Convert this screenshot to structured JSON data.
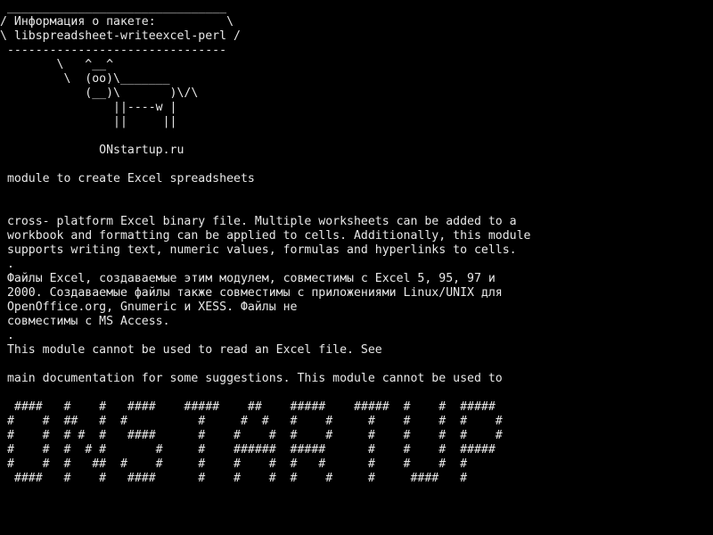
{
  "colors": {
    "background": "#000000",
    "text": "#e8e8e8"
  },
  "cowsay": {
    "bubble_top": " _______________________________",
    "bubble_line1": "/ Информация о пакете:          \\",
    "bubble_line2": "\\ libspreadsheet-writeexcel-perl /",
    "bubble_bottom": " -------------------------------",
    "cow_line1": "        \\   ^__^",
    "cow_line2": "         \\  (oo)\\_______",
    "cow_line3": "            (__)\\       )\\/\\",
    "cow_line4": "                ||----w |",
    "cow_line5": "                ||     ||"
  },
  "site_label": "              ONstartup.ru",
  "summary": " module to create Excel spreadsheets",
  "description": {
    "line1": " cross- platform Excel binary file. Multiple worksheets can be added to a",
    "line2": " workbook and formatting can be applied to cells. Additionally, this module",
    "line3": " supports writing text, numeric values, formulas and hyperlinks to cells.",
    "line4": " .",
    "line5": " Файлы Excel, создаваемые этим модулем, совместимы с Excel 5, 95, 97 и",
    "line6": " 2000. Создаваемые файлы также совместимы с приложениями Linux/UNIX для",
    "line7": " OpenOffice.org, Gnumeric и XESS. Файлы не",
    "line8": " совместимы с MS Access.",
    "line9": " .",
    "line10": " This module cannot be used to read an Excel file. See",
    "line11": "",
    "line12": " main documentation for some suggestions. This module cannot be used to"
  },
  "banner": {
    "line1": "  ####   #    #   ####    #####    ##    #####    #####  #    #  #####",
    "line2": " #    #  ##   #  #          #     #  #   #    #     #    #    #  #    #",
    "line3": " #    #  # #  #   ####      #    #    #  #    #     #    #    #  #    #",
    "line4": " #    #  #  # #       #     #    ######  #####      #    #    #  #####",
    "line5": " #    #  #   ##  #    #     #    #    #  #   #      #    #    #  #",
    "line6": "  ####   #    #   ####      #    #    #  #    #     #     ####   #"
  }
}
